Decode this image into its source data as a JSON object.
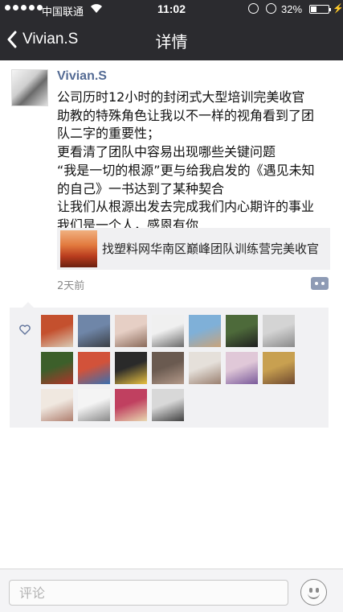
{
  "status_bar": {
    "carrier": "中国联通",
    "time": "11:02",
    "battery_percent": "32%",
    "battery_level": 0.32
  },
  "nav": {
    "back_label": "Vivian.S",
    "title": "详情"
  },
  "post": {
    "author": "Vivian.S",
    "lines": [
      "公司历时12小时的封闭式大型培训完美收官",
      "助教的特殊角色让我以不一样的视角看到了团",
      "队二字的重要性；",
      "更看清了团队中容易出现哪些关键问题",
      "“我是一切的根源”更与给我启发的《遇见未知",
      "的自己》一书达到了某种契合",
      "让我们从根源出发去完成我们内心期许的事业",
      "我们是一个人，感恩有你"
    ],
    "link_title": "找塑料网华南区巅峰团队训练营完美收官",
    "time_ago": "2天前"
  },
  "likes": {
    "avatar_colors": [
      [
        "#c4502e",
        "#d9cbb5"
      ],
      [
        "#6f86a8",
        "#3b3f45"
      ],
      [
        "#e6cfc5",
        "#8a6a5a"
      ],
      [
        "#f0f0f0",
        "#6a6a6a"
      ],
      [
        "#7fb0d8",
        "#c9a37a"
      ],
      [
        "#4d6a3a",
        "#202020"
      ],
      [
        "#d4d4d4",
        "#8a8a8a"
      ],
      [
        "#3c5f2a",
        "#b0342a"
      ],
      [
        "#d2523a",
        "#3a6fb0"
      ],
      [
        "#2a2a2a",
        "#e8c040"
      ],
      [
        "#6a5a50",
        "#b49a8a"
      ],
      [
        "#e5e0da",
        "#9a8070"
      ],
      [
        "#e0c8d8",
        "#7a5a9a"
      ],
      [
        "#c8a050",
        "#704a30"
      ],
      [
        "#f0e8e0",
        "#b08070"
      ],
      [
        "#f4f4f4",
        "#8a8a8a"
      ],
      [
        "#c04060",
        "#e8d8b0"
      ],
      [
        "#d8d8d8",
        "#404040"
      ]
    ]
  },
  "input": {
    "placeholder": "评论"
  }
}
